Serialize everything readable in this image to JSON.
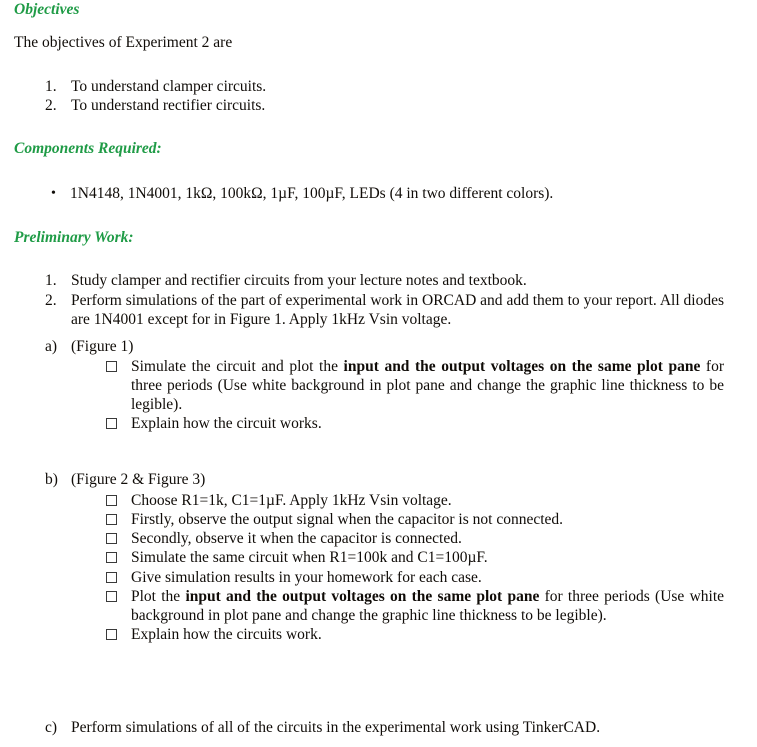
{
  "document": {
    "accent_color": "#1f9b46",
    "text_color": "#100c08",
    "background": "#ffffff"
  },
  "sections": {
    "objectives": {
      "heading": "Objectives",
      "intro": "The objectives of Experiment 2 are",
      "items": [
        {
          "marker": "1.",
          "text": "To understand clamper circuits."
        },
        {
          "marker": "2.",
          "text": "To understand rectifier circuits."
        }
      ]
    },
    "components": {
      "heading": "Components Required:",
      "bullet": "•",
      "items": [
        {
          "text": "1N4148, 1N4001, 1kΩ, 100kΩ, 1µF, 100µF, LEDs (4 in two different colors)."
        }
      ]
    },
    "preliminary": {
      "heading": "Preliminary Work:",
      "numbered": [
        {
          "marker": "1.",
          "text": "Study clamper and rectifier circuits from your lecture notes and textbook."
        },
        {
          "marker": "2.",
          "text": "Perform simulations of the part of experimental work in ORCAD and add them to your report.  All diodes are 1N4001 except for in Figure 1. Apply 1kHz Vsin voltage."
        }
      ],
      "parts": [
        {
          "marker": "a)",
          "title": "(Figure 1)",
          "checkitems": [
            {
              "pre": "Simulate the circuit and plot the ",
              "bold": "input and the output voltages on the same plot pane",
              "post": " for three periods (Use white background in plot pane and change the graphic line thickness to be legible)."
            },
            {
              "pre": "Explain how the circuit works.",
              "bold": "",
              "post": ""
            }
          ]
        },
        {
          "marker": "b)",
          "title": "(Figure 2 & Figure 3)",
          "checkitems": [
            {
              "pre": "Choose R1=1k, C1=1µF. Apply 1kHz Vsin voltage.",
              "bold": "",
              "post": ""
            },
            {
              "pre": "Firstly, observe the output signal when the capacitor is not connected.",
              "bold": "",
              "post": ""
            },
            {
              "pre": "Secondly, observe it when the capacitor is connected.",
              "bold": "",
              "post": ""
            },
            {
              "pre": "Simulate the same circuit when R1=100k and C1=100µF.",
              "bold": "",
              "post": ""
            },
            {
              "pre": "Give simulation results in your homework for each case.",
              "bold": "",
              "post": ""
            },
            {
              "pre": "Plot the ",
              "bold": "input and the output voltages on the same plot pane",
              "post": " for three periods (Use white background in plot pane and change the graphic line thickness to be legible)."
            },
            {
              "pre": "Explain how the circuits work.",
              "bold": "",
              "post": ""
            }
          ]
        },
        {
          "marker": "c)",
          "title": "Perform simulations of all of the circuits in the experimental work using TinkerCAD.",
          "checkitems": []
        }
      ]
    }
  }
}
